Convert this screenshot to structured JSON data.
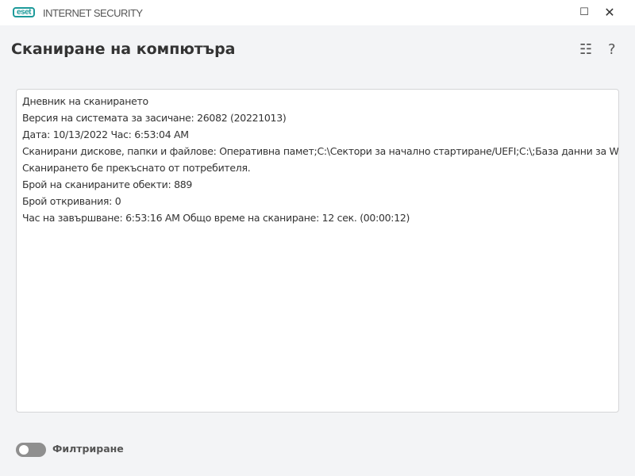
{
  "app": {
    "logo": "eset",
    "product": "INTERNET SECURITY"
  },
  "window": {
    "minimize": "☐",
    "close": "✕"
  },
  "header": {
    "title": "Сканиране на компютъра",
    "list_icon": "☷",
    "help": "?"
  },
  "log": {
    "lines": [
      "Дневник на сканирането",
      "Версия на системата за засичане: 26082 (20221013)",
      "Дата: 10/13/2022  Час: 6:53:04 AM",
      "Сканирани дискове, папки и файлове: Оперативна памет;C:\\Сектори за начално стартиране/UEFI;C:\\;База данни за WMI...",
      "Сканирането бе прекъснато от потребителя.",
      "Брой на сканираните обекти: 889",
      "Брой откривания: 0",
      "Час на завършване: 6:53:16 AM  Общо време на сканиране: 12 сек. (00:00:12)"
    ]
  },
  "filter": {
    "label": "Филтриране",
    "enabled": false
  }
}
